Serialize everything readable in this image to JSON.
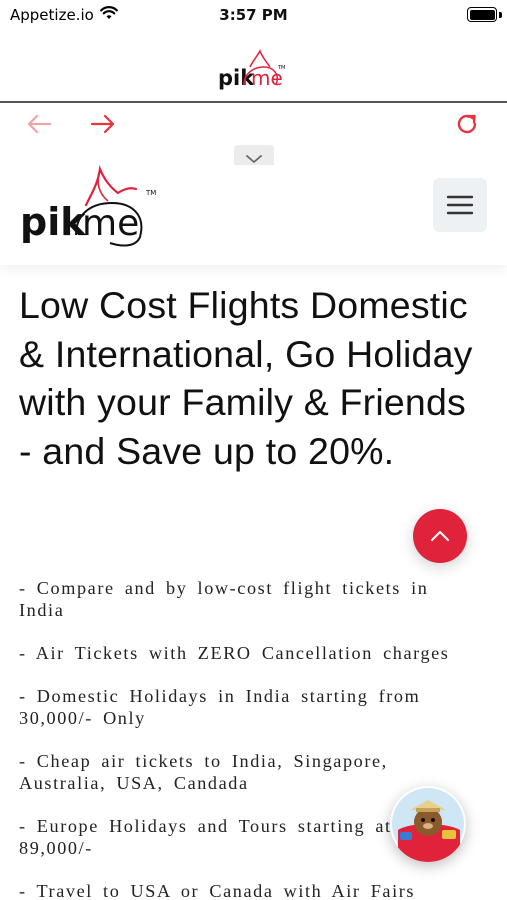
{
  "status_bar": {
    "carrier": "Appetize.io",
    "time": "3:57 PM",
    "wifi_icon": "wifi-icon",
    "battery_icon": "battery-full-icon"
  },
  "app_header": {
    "logo_text_pik": "pik",
    "logo_text_me": "me",
    "logo_tm": "TM"
  },
  "browser_nav": {
    "back_icon": "arrow-left-icon",
    "forward_icon": "arrow-right-icon",
    "reload_icon": "reload-icon",
    "collapse_icon": "chevron-down-icon",
    "colors": {
      "back": "#f2a3a8",
      "active": "#e8343f"
    }
  },
  "site_header": {
    "logo_text_pik": "pik",
    "logo_text_me": "me",
    "logo_tm": "TM",
    "menu_icon": "hamburger-menu-icon"
  },
  "hero": {
    "title": "Low Cost Flights Domestic & International, Go Holiday with your Family & Friends - and Save up to 20%."
  },
  "bullets": [
    "- Compare and by low-cost flight tickets in India",
    "- Air Tickets with ZERO Cancellation charges",
    "- Domestic Holidays in India starting from 30,000/- Only",
    "- Cheap air tickets to India, Singapore, Australia, USA, Candada",
    "- Europe Holidays and Tours starting at Rs 89,000/-",
    "- Travel to USA or Canada with Air Fairs"
  ],
  "floating": {
    "scroll_top_icon": "chevron-up-icon",
    "chat_icon": "chat-avatar-icon"
  },
  "colors": {
    "brand_red": "#e0223a",
    "text": "#111111"
  }
}
